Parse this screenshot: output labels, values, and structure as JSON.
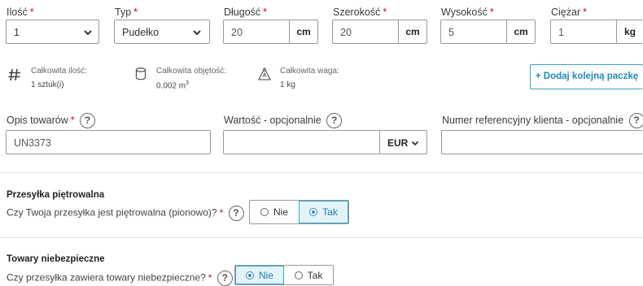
{
  "package_row": {
    "quantity": {
      "label": "Ilość",
      "required_mark": "*",
      "value": "1"
    },
    "type": {
      "label": "Typ",
      "required_mark": "*",
      "value": "Pudełko"
    },
    "length": {
      "label": "Długość",
      "required_mark": "*",
      "value": "20",
      "unit": "cm"
    },
    "width": {
      "label": "Szerokość",
      "required_mark": "*",
      "value": "20",
      "unit": "cm"
    },
    "height": {
      "label": "Wysokość",
      "required_mark": "*",
      "value": "5",
      "unit": "cm"
    },
    "weight": {
      "label": "Ciężar",
      "required_mark": "*",
      "value": "1",
      "unit": "kg"
    }
  },
  "summary": {
    "total_quantity": {
      "title": "Całkowita ilość:",
      "value": "1 sztuk(i)",
      "icon": "hash-icon"
    },
    "total_volume": {
      "title": "Całkowita objętość:",
      "value": "0.002 m",
      "unit_superscript": "3",
      "icon": "cylinder-icon"
    },
    "total_weight": {
      "title": "Całkowita waga:",
      "value": "1 kg",
      "icon": "weight-icon"
    },
    "add_package_label": "+ Dodaj kolejną paczkę"
  },
  "details": {
    "description": {
      "label": "Opis towarów",
      "required_mark": "*",
      "value": "UN3373",
      "help": "?"
    },
    "value": {
      "label": "Wartość - opcjonalnie",
      "value": "",
      "currency": "EUR",
      "help": "?"
    },
    "reference": {
      "label": "Numer referencyjny klienta - opcjonalnie",
      "value": "",
      "help": "?"
    }
  },
  "stackable": {
    "title": "Przesyłka piętrowalna",
    "question": "Czy Twoja przesyłka jest piętrowalna (pionowo)?",
    "required_mark": "*",
    "help": "?",
    "options": [
      "Nie",
      "Tak"
    ],
    "selected": "Tak"
  },
  "dangerous": {
    "title": "Towary niebezpieczne",
    "question": "Czy przesyłka zawiera towary niebezpieczne?",
    "required_mark": "*",
    "help": "?",
    "options": [
      "Nie",
      "Tak"
    ],
    "selected": "Nie"
  },
  "colors": {
    "required": "#d6001c",
    "accent": "#1f88c0",
    "selected_bg": "#e3f3fa",
    "border": "#9a9a9a"
  }
}
